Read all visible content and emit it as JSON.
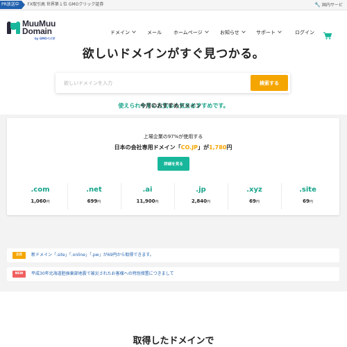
{
  "topbar": {
    "pr_badge": "PR放送中",
    "pr_text": "FX取引高 世界第１位 GMOクリック証券",
    "pr_chevron": "›",
    "intl_icon": "wrench-icon",
    "intl_label": "国内サービ"
  },
  "header": {
    "logo_line1": "MuuMuu",
    "logo_line2": "Domain",
    "logo_sub": "by GMOペパボ",
    "nav": [
      {
        "label": "ドメイン",
        "caret": true
      },
      {
        "label": "メール",
        "caret": false
      },
      {
        "label": "ホームページ",
        "caret": true
      },
      {
        "label": "お知らせ",
        "caret": true
      },
      {
        "label": "サポート",
        "caret": true
      },
      {
        "label": "ログイン",
        "caret": false
      }
    ],
    "cart_icon": "cart-icon",
    "accent_color": "#18b79b"
  },
  "hero": {
    "title": "欲しいドメインがすぐ見つかる。",
    "search_placeholder": "欲しいドメインを入力",
    "search_value": "",
    "search_button": "検索する",
    "tagline_green": "使えられやすい人気の人気をおすすめです。",
    "tagline_dark": "今月のおすすめドメイン"
  },
  "promo": {
    "line1": "上場企業の97%が使用する",
    "line2_prefix": "日本の会社専用ドメイン「",
    "line2_domain": "CO.JP",
    "line2_middle": "」が",
    "line2_price": "1,780",
    "line2_suffix": "円",
    "detail_button": "詳細を見る",
    "accent_color": "#f5a500"
  },
  "tlds": [
    {
      "name": ".com",
      "price": "1,060",
      "unit": "円"
    },
    {
      "name": ".net",
      "price": "699",
      "unit": "円"
    },
    {
      "name": ".ai",
      "price": "11,900",
      "unit": "円"
    },
    {
      "name": ".jp",
      "price": "2,840",
      "unit": "円"
    },
    {
      "name": ".xyz",
      "price": "69",
      "unit": "円"
    },
    {
      "name": ".site",
      "price": "69",
      "unit": "円"
    }
  ],
  "news": [
    {
      "badge": "注目",
      "badge_color": "#f5a500",
      "text": "新ドメイン「.site」「.online」「.pw」が69円から取得できます。"
    },
    {
      "badge": "NEW",
      "badge_color": "#ef6060",
      "text": "平成30年北海道胆振東部地震で被災されたお客様への特別措置につきまして"
    }
  ],
  "bottom": {
    "title": "取得したドメインで"
  }
}
